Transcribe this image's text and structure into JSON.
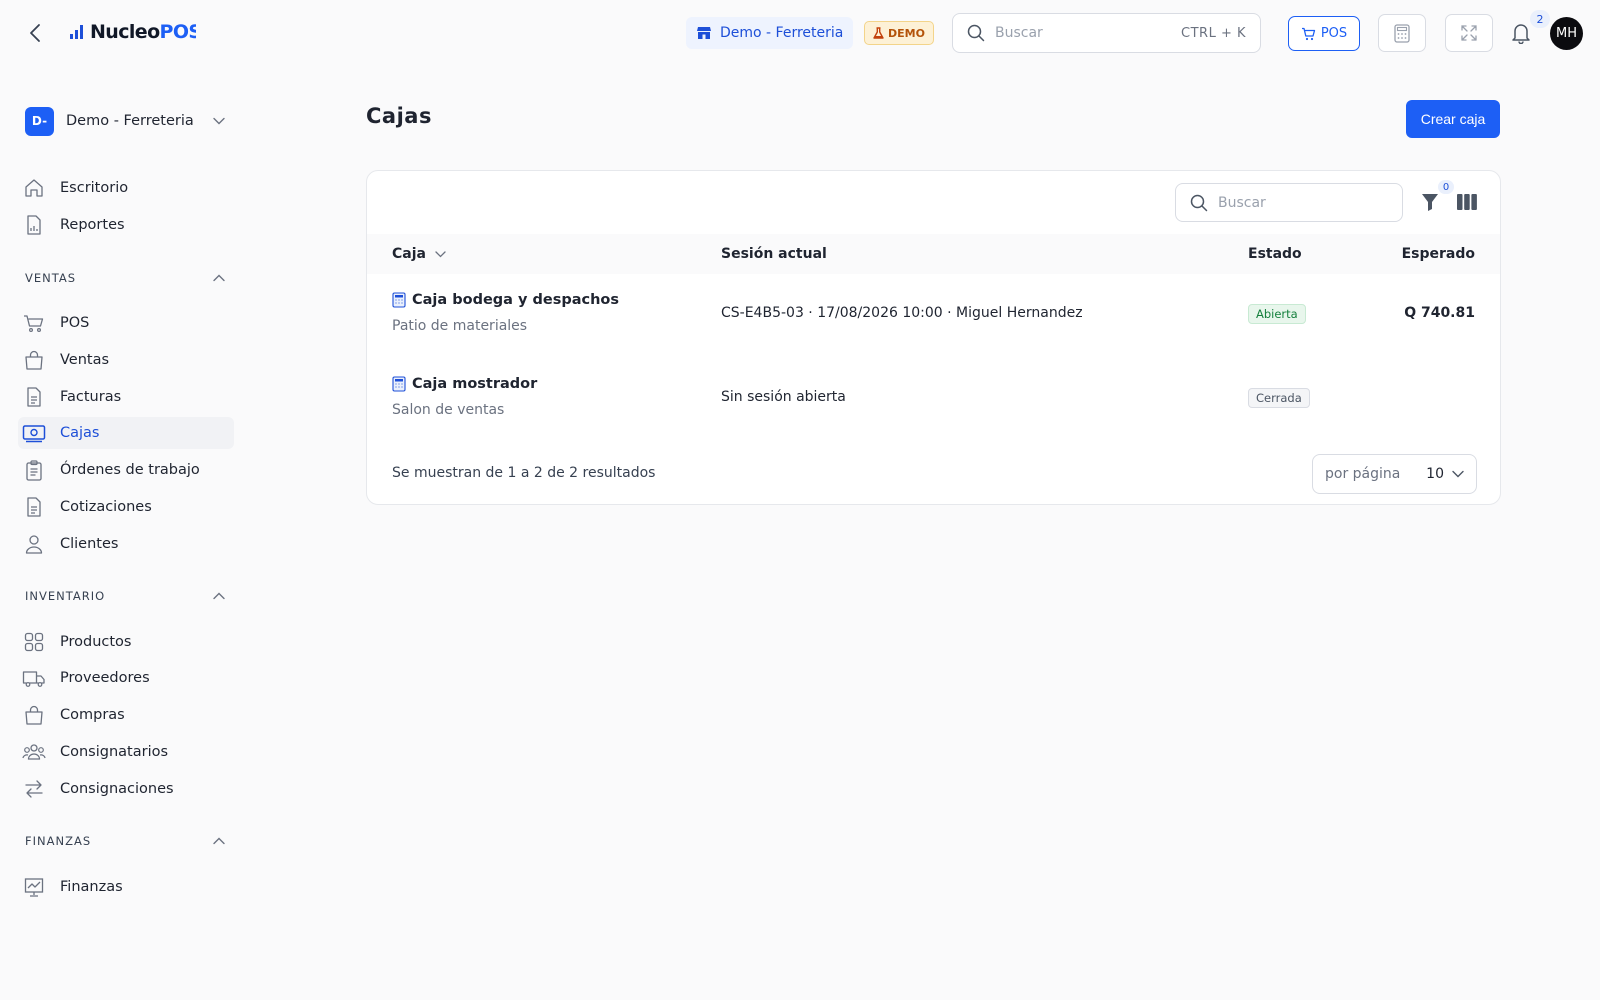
{
  "topbar": {
    "logo_text": "Nucleo",
    "logo_accent": "POS",
    "store_name": "Demo - Ferreteria",
    "demo_badge": "DEMO",
    "search_placeholder": "Buscar",
    "search_shortcut": "CTRL + K",
    "pos_button": "POS",
    "notifications_count": "2",
    "avatar_initials": "MH"
  },
  "sidebar": {
    "org_initials": "D-",
    "org_name": "Demo - Ferreteria",
    "top_items": [
      {
        "label": "Escritorio",
        "icon": "home-icon"
      },
      {
        "label": "Reportes",
        "icon": "report-icon"
      }
    ],
    "sections": [
      {
        "title": "VENTAS",
        "items": [
          {
            "label": "POS",
            "icon": "cart-icon"
          },
          {
            "label": "Ventas",
            "icon": "bag-icon"
          },
          {
            "label": "Facturas",
            "icon": "document-icon"
          },
          {
            "label": "Cajas",
            "icon": "cash-icon",
            "active": true
          },
          {
            "label": "Órdenes de trabajo",
            "icon": "clipboard-icon"
          },
          {
            "label": "Cotizaciones",
            "icon": "document-icon"
          },
          {
            "label": "Clientes",
            "icon": "user-icon"
          }
        ]
      },
      {
        "title": "INVENTARIO",
        "items": [
          {
            "label": "Productos",
            "icon": "grid-icon"
          },
          {
            "label": "Proveedores",
            "icon": "truck-icon"
          },
          {
            "label": "Compras",
            "icon": "bag-icon"
          },
          {
            "label": "Consignatarios",
            "icon": "users-icon"
          },
          {
            "label": "Consignaciones",
            "icon": "arrows-icon"
          }
        ]
      },
      {
        "title": "FINANZAS",
        "items": [
          {
            "label": "Finanzas",
            "icon": "chart-icon"
          }
        ]
      }
    ]
  },
  "main": {
    "title": "Cajas",
    "create_button": "Crear caja",
    "table_search_placeholder": "Buscar",
    "filter_count": "0",
    "columns": [
      "Caja",
      "Sesión actual",
      "Estado",
      "Esperado"
    ],
    "rows": [
      {
        "name": "Caja bodega y despachos",
        "location": "Patio de materiales",
        "session": "CS-E4B5-03 · 17/08/2026 10:00 · Miguel Hernandez",
        "status": "Abierta",
        "expected": "Q 740.81"
      },
      {
        "name": "Caja mostrador",
        "location": "Salon de ventas",
        "session": "Sin sesión abierta",
        "status": "Cerrada",
        "expected": ""
      }
    ],
    "results_text": "Se muestran de 1 a 2 de 2 resultados",
    "per_page_label": "por página",
    "per_page_value": "10"
  },
  "colors": {
    "accent": "#1d5ff5",
    "open_status": "#15803d",
    "closed_status": "#4b5563"
  }
}
